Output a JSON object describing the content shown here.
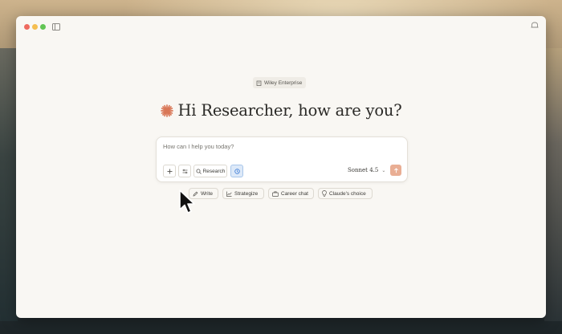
{
  "window": {
    "icons": [
      "sidebar-toggle-icon",
      "incognito-icon"
    ]
  },
  "workspace": {
    "label": "Wiley Enterprise",
    "icon": "building-icon"
  },
  "greeting": {
    "text": "Hi Researcher, how are you?",
    "icon": "claude-spark-icon",
    "icon_color": "#d97757"
  },
  "composer": {
    "placeholder": "How can I help you today?",
    "research_label": "Research",
    "model_label": "Sonnet 4.5",
    "send_color": "#e9ae94"
  },
  "chips": [
    {
      "label": "Write",
      "icon": "pencil-icon"
    },
    {
      "label": "Strategize",
      "icon": "chart-icon"
    },
    {
      "label": "Career chat",
      "icon": "briefcase-icon"
    },
    {
      "label": "Claude's choice",
      "icon": "lightbulb-icon"
    }
  ]
}
